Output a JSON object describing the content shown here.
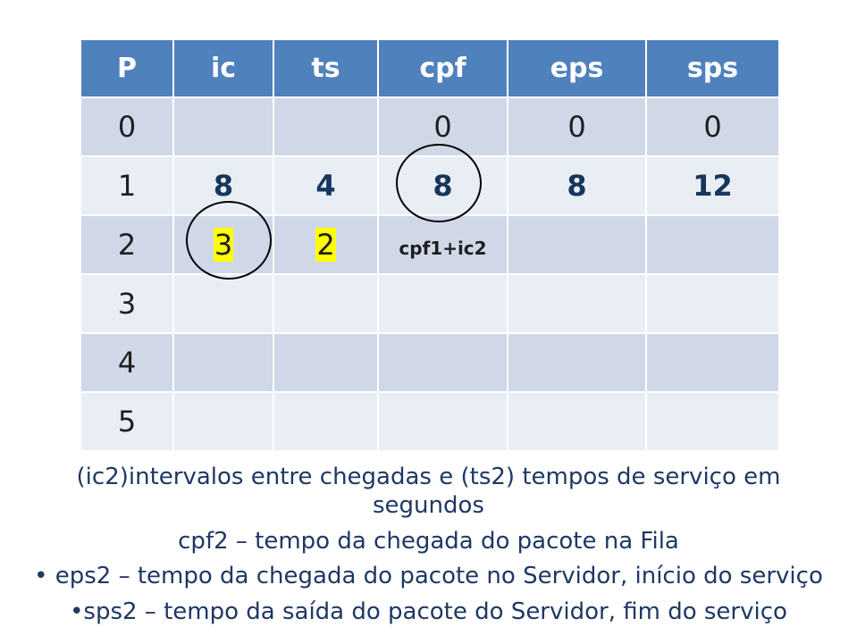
{
  "table": {
    "headers": [
      "P",
      "ic",
      "ts",
      "cpf",
      "eps",
      "sps"
    ],
    "rows": [
      {
        "P": "0",
        "ic": "",
        "ts": "",
        "cpf": "0",
        "eps": "0",
        "sps": "0"
      },
      {
        "P": "1",
        "ic": "8",
        "ts": "4",
        "cpf": "8",
        "eps": "8",
        "sps": "12"
      },
      {
        "P": "2",
        "ic": "3",
        "ts": "2",
        "cpf": "cpf1+ic2",
        "eps": "",
        "sps": ""
      },
      {
        "P": "3",
        "ic": "",
        "ts": "",
        "cpf": "",
        "eps": "",
        "sps": ""
      },
      {
        "P": "4",
        "ic": "",
        "ts": "",
        "cpf": "",
        "eps": "",
        "sps": ""
      },
      {
        "P": "5",
        "ic": "",
        "ts": "",
        "cpf": "",
        "eps": "",
        "sps": ""
      }
    ]
  },
  "captions": [
    "(ic2)intervalos entre chegadas e (ts2) tempos de serviço em segundos",
    "cpf2 – tempo da chegada do pacote na Fila",
    "• eps2 – tempo da chegada do pacote no Servidor, início do serviço",
    "•sps2 – tempo da saída do pacote do Servidor, fim do serviço"
  ],
  "colors": {
    "header_bg": "#4f81bd",
    "row_dark": "#d0d8e8",
    "row_light": "#e9edf4",
    "highlight": "#ffff00",
    "caption_text": "#1f3864"
  }
}
